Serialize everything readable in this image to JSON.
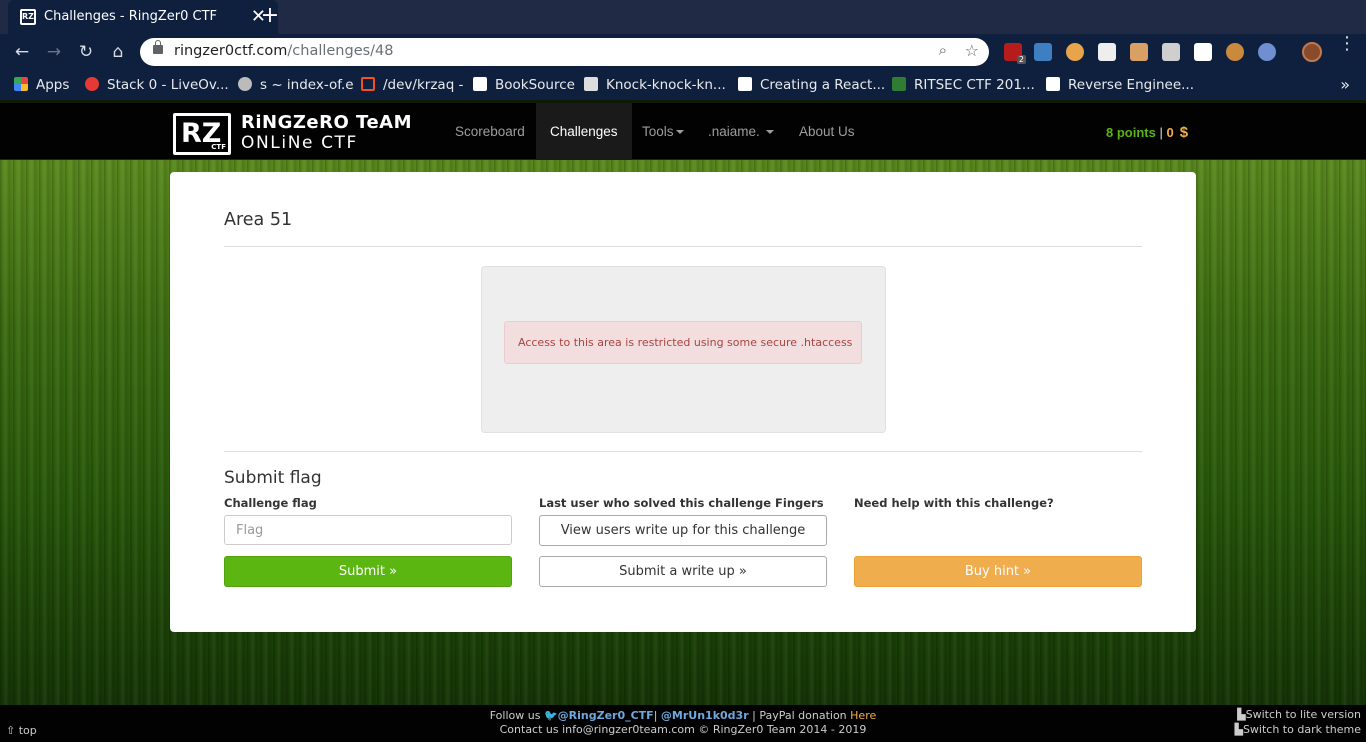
{
  "browser": {
    "tab_title": "Challenges - RingZer0 CTF",
    "tab_close": "✕",
    "new_tab": "+",
    "url_host": "ringzer0ctf.com",
    "url_path": "/challenges/48",
    "bookmarks": [
      {
        "label": "Apps",
        "icon_color": "#e8453c"
      },
      {
        "label": "Stack 0 - LiveOv...",
        "icon_color": "#e53935"
      },
      {
        "label": "s ~ index-of.e",
        "icon_color": "#cccccc"
      },
      {
        "label": "/dev/krzaq -",
        "icon_color": "#f4511e"
      },
      {
        "label": "BookSource",
        "icon_color": "#ffffff"
      },
      {
        "label": "Knock-knock-kn...",
        "icon_color": "#dddddd"
      },
      {
        "label": "Creating a React...",
        "icon_color": "#ffffff"
      },
      {
        "label": "RITSEC CTF 201...",
        "icon_color": "#2e7d32"
      },
      {
        "label": "Reverse Enginee...",
        "icon_color": "#ffffff"
      }
    ],
    "bookmarks_more": "»",
    "extension_badge": "2"
  },
  "site": {
    "logo_mark": "RZ",
    "logo_mark_small": "CTF",
    "logo_line1": "RiNGZeRO TeAM",
    "logo_line2": "ONLiNe CTF",
    "nav": {
      "scoreboard": "Scoreboard",
      "challenges": "Challenges",
      "tools": "Tools",
      "user": ".naiame.",
      "about": "About Us"
    },
    "points": "8 points",
    "points_sep": "|",
    "coins": "0",
    "currency": "$"
  },
  "challenge": {
    "title": "Area 51",
    "alert": "Access to this area is restricted using some secure .htaccess",
    "submit_title": "Submit flag",
    "flag_label": "Challenge flag",
    "flag_placeholder": "Flag",
    "last_solver_label": "Last user who solved this challenge",
    "last_solver": "Fingers",
    "help_label": "Need help with this challenge?",
    "view_writeups": "View users write up for this challenge",
    "submit_button": "Submit »",
    "submit_writeup": "Submit a write up »",
    "buy_hint": "Buy hint »"
  },
  "footer": {
    "follow": "Follow us",
    "twitter1": "@RingZer0_CTF",
    "twitter2": "@MrUn1k0d3r",
    "paypal": "| PayPal donation",
    "here": "Here",
    "contact": "Contact us info@ringzer0team.com © RingZer0 Team 2014 - 2019",
    "top": "top",
    "lite": "Switch to lite version",
    "dark": "Switch to dark theme"
  }
}
